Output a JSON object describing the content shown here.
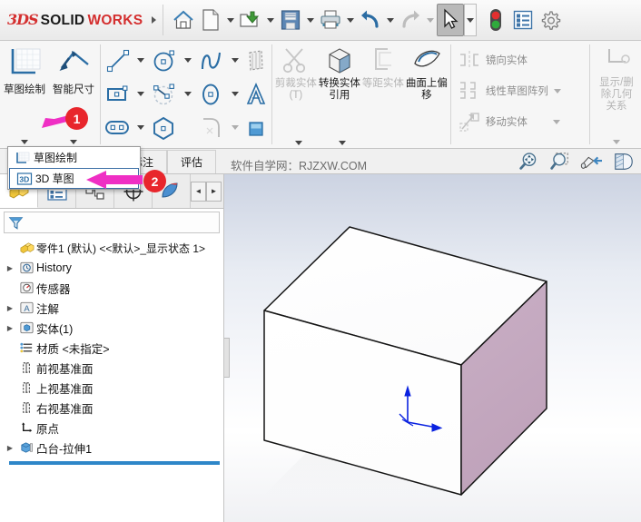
{
  "app": {
    "brand_ds": "3DS",
    "brand_solid": "SOLID",
    "brand_works": "WORKS"
  },
  "topbar": {
    "icons": [
      {
        "name": "home-icon",
        "label": "主页"
      },
      {
        "name": "new-document-icon",
        "label": "新建"
      },
      {
        "name": "open-folder-icon",
        "label": "打开"
      },
      {
        "name": "save-icon",
        "label": "保存"
      },
      {
        "name": "print-icon",
        "label": "打印"
      },
      {
        "name": "undo-icon",
        "label": "撤销"
      },
      {
        "name": "redo-icon",
        "label": "重做"
      },
      {
        "name": "select-cursor-icon",
        "label": "选择"
      },
      {
        "name": "rebuild-traffic-light-icon",
        "label": "重建模型"
      },
      {
        "name": "options-list-icon",
        "label": "选项"
      },
      {
        "name": "settings-gear-icon",
        "label": "设置"
      }
    ]
  },
  "ribbon": {
    "sketch_button": {
      "label": "草图绘制",
      "icon": "sketch-icon"
    },
    "smart_dimension_button": {
      "label": "智能尺寸",
      "icon": "smart-dimension-icon"
    },
    "entity_tools": [
      {
        "name": "line-tool",
        "has_dropdown": true
      },
      {
        "name": "circle-tool",
        "has_dropdown": true
      },
      {
        "name": "spline-tool",
        "has_dropdown": true
      },
      {
        "name": "sketch-pattern-tool",
        "has_dropdown": false
      },
      {
        "name": "rectangle-tool",
        "has_dropdown": true
      },
      {
        "name": "arc-tool",
        "has_dropdown": true
      },
      {
        "name": "ellipse-tool",
        "has_dropdown": true
      },
      {
        "name": "text-tool",
        "has_dropdown": false
      },
      {
        "name": "slot-tool",
        "has_dropdown": true
      },
      {
        "name": "polygon-tool",
        "has_dropdown": false
      },
      {
        "name": "sketch-fillet-tool",
        "has_dropdown": true
      },
      {
        "name": "shaded-sketch-contour-tool",
        "has_dropdown": false
      }
    ],
    "med_buttons": [
      {
        "label": "剪裁实体(T)",
        "icon": "trim-entities-icon",
        "disabled": true,
        "has_dropdown": true
      },
      {
        "label": "转换实体引用",
        "icon": "convert-entities-icon",
        "disabled": false,
        "has_dropdown": true
      },
      {
        "label": "等距实体",
        "icon": "offset-entities-icon",
        "disabled": true,
        "has_dropdown": false
      },
      {
        "label": "曲面上偏移",
        "icon": "offset-on-surface-icon",
        "disabled": false,
        "has_dropdown": false
      }
    ],
    "list_buttons": [
      {
        "label": "镜向实体",
        "icon": "mirror-entities-icon",
        "disabled": true,
        "has_dropdown": false
      },
      {
        "label": "线性草图阵列",
        "icon": "linear-sketch-pattern-icon",
        "disabled": true,
        "has_dropdown": true
      },
      {
        "label": "移动实体",
        "icon": "move-entities-icon",
        "disabled": true,
        "has_dropdown": true
      }
    ],
    "display_relations": {
      "label_line1": "显示/删",
      "label_line2": "除几何",
      "label_line3": "关系",
      "icon": "display-delete-relations-icon",
      "disabled": true
    }
  },
  "tabs": {
    "items": [
      {
        "label": "标注",
        "name": "tab-annotation"
      },
      {
        "label": "评估",
        "name": "tab-evaluate"
      }
    ],
    "watermark": "软件自学网：RJZXW.COM",
    "view_tools": [
      {
        "name": "zoom-to-fit-icon"
      },
      {
        "name": "zoom-to-area-icon"
      },
      {
        "name": "view-orientation-icon"
      },
      {
        "name": "section-view-icon"
      }
    ]
  },
  "dropdown_menu": {
    "items": [
      {
        "label": "草图绘制",
        "icon": "sketch-2d-icon",
        "selected": false,
        "name": "menu-item-sketch"
      },
      {
        "label": "3D 草图",
        "icon": "sketch-3d-icon",
        "selected": true,
        "name": "menu-item-3d-sketch"
      }
    ]
  },
  "feature_manager": {
    "tabs": [
      {
        "name": "feature-manager-tab",
        "icon": "part-tree-icon",
        "active": true
      },
      {
        "name": "property-manager-tab",
        "icon": "property-list-icon",
        "active": false
      },
      {
        "name": "configuration-manager-tab",
        "icon": "configuration-icon",
        "active": false
      },
      {
        "name": "dimxpert-manager-tab",
        "icon": "dimxpert-icon",
        "active": false
      },
      {
        "name": "display-manager-tab",
        "icon": "display-manager-icon",
        "active": false
      }
    ],
    "nav_prev": "◄",
    "nav_next": "►",
    "filter_icon": "filter-funnel-icon",
    "part_title": "零件1 (默认) <<默认>_显示状态 1>",
    "tree": [
      {
        "label": "History",
        "icon": "history-icon",
        "expandable": true,
        "indent": 0
      },
      {
        "label": "传感器",
        "icon": "sensors-icon",
        "expandable": false,
        "indent": 0
      },
      {
        "label": "注解",
        "icon": "annotations-icon",
        "expandable": true,
        "indent": 0
      },
      {
        "label": "实体(1)",
        "icon": "solid-bodies-icon",
        "expandable": true,
        "indent": 0
      },
      {
        "label": "材质 <未指定>",
        "icon": "material-icon",
        "expandable": false,
        "indent": 0
      },
      {
        "label": "前视基准面",
        "icon": "plane-icon",
        "expandable": false,
        "indent": 0
      },
      {
        "label": "上视基准面",
        "icon": "plane-icon",
        "expandable": false,
        "indent": 0
      },
      {
        "label": "右视基准面",
        "icon": "plane-icon",
        "expandable": false,
        "indent": 0
      },
      {
        "label": "原点",
        "icon": "origin-icon",
        "expandable": false,
        "indent": 0
      },
      {
        "label": "凸台-拉伸1",
        "icon": "extrude-boss-icon",
        "expandable": true,
        "indent": 0
      }
    ]
  },
  "graphics": {
    "model_name": "凸台-拉伸1",
    "origin_triad": "origin-triad",
    "colors": {
      "face_front": "#ffffff",
      "face_top": "#fdfdfd",
      "face_right": "#c5a9c0",
      "edge": "#1a1a1a",
      "triad": "#0a22e0"
    }
  },
  "annotations": [
    {
      "number": "1",
      "name": "step-badge-1"
    },
    {
      "number": "2",
      "name": "step-badge-2"
    }
  ],
  "colors": {
    "accent_red": "#e8262c",
    "arrow_magenta": "#ef2fc4",
    "brand_red": "#d42f2f",
    "rollback_blue": "#2e86c8"
  }
}
